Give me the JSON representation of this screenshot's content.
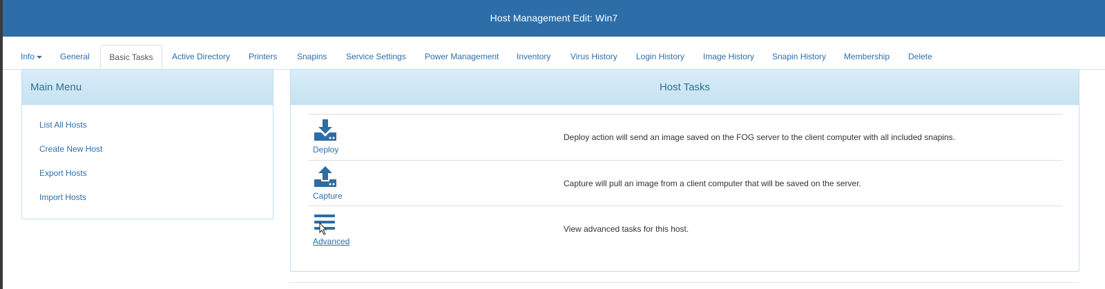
{
  "header": {
    "title": "Host Management Edit: Win7"
  },
  "tabs": [
    {
      "label": "Info"
    },
    {
      "label": "General"
    },
    {
      "label": "Basic Tasks"
    },
    {
      "label": "Active Directory"
    },
    {
      "label": "Printers"
    },
    {
      "label": "Snapins"
    },
    {
      "label": "Service Settings"
    },
    {
      "label": "Power Management"
    },
    {
      "label": "Inventory"
    },
    {
      "label": "Virus History"
    },
    {
      "label": "Login History"
    },
    {
      "label": "Image History"
    },
    {
      "label": "Snapin History"
    },
    {
      "label": "Membership"
    },
    {
      "label": "Delete"
    }
  ],
  "active_tab": "Basic Tasks",
  "main_menu": {
    "title": "Main Menu",
    "items": [
      {
        "label": "List All Hosts"
      },
      {
        "label": "Create New Host"
      },
      {
        "label": "Export Hosts"
      },
      {
        "label": "Import Hosts"
      }
    ]
  },
  "host_tasks": {
    "title": "Host Tasks",
    "tasks": [
      {
        "label": "Deploy",
        "icon": "deploy-icon",
        "description": "Deploy action will send an image saved on the FOG server to the client computer with all included snapins."
      },
      {
        "label": "Capture",
        "icon": "capture-icon",
        "description": "Capture will pull an image from a client computer that will be saved on the server."
      },
      {
        "label": "Advanced",
        "icon": "advanced-icon",
        "description": "View advanced tasks for this host."
      }
    ]
  },
  "colors": {
    "header_bg": "#2d6ea8",
    "link": "#2d6ea8",
    "panel_head_bg": "#d9edf7",
    "panel_head_text": "#31708f",
    "icon": "#2e6da4"
  }
}
